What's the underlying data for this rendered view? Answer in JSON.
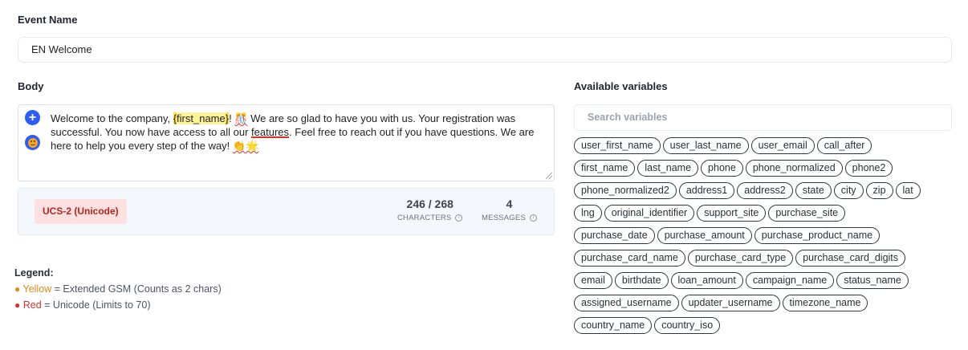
{
  "event": {
    "label": "Event Name",
    "value": "EN Welcome"
  },
  "body": {
    "label": "Body",
    "text_1": "Welcome to the company, ",
    "brace_open": "{",
    "var_name": "first_name",
    "brace_close": "}",
    "text_2": "! ",
    "emoji_1": "🎊",
    "text_3": " We are so glad to have you with us. Your registration was successful. You now have access to all our ",
    "misspelled": "features",
    "text_4": ". Feel free to reach out if you have questions. We are here to help you every step of the way! ",
    "emoji_2": "👏🌟",
    "add_button": "+"
  },
  "stats": {
    "encoding": "UCS-2 (Unicode)",
    "characters_value": "246 / 268",
    "characters_label": "CHARACTERS",
    "messages_value": "4",
    "messages_label": "MESSAGES",
    "info_glyph": "i"
  },
  "legend": {
    "title": "Legend:",
    "bullet": "●",
    "yellow_word": "Yellow",
    "yellow_desc": " = Extended GSM (Counts as 2 chars)",
    "red_word": "Red",
    "red_desc": " = Unicode (Limits to 70)"
  },
  "variables": {
    "label": "Available variables",
    "search_placeholder": "Search variables",
    "rows": [
      [
        "user_first_name",
        "user_last_name",
        "user_email",
        "call_after"
      ],
      [
        "first_name",
        "last_name",
        "phone",
        "phone_normalized",
        "phone2"
      ],
      [
        "phone_normalized2",
        "address1",
        "address2",
        "state",
        "city",
        "zip",
        "lat"
      ],
      [
        "lng",
        "original_identifier",
        "support_site",
        "purchase_site"
      ],
      [
        "purchase_date",
        "purchase_amount",
        "purchase_product_name"
      ],
      [
        "purchase_card_name",
        "purchase_card_type",
        "purchase_card_digits"
      ],
      [
        "email",
        "birthdate",
        "loan_amount",
        "campaign_name",
        "status_name"
      ],
      [
        "assigned_username",
        "updater_username",
        "timezone_name"
      ],
      [
        "country_name",
        "country_iso"
      ]
    ]
  },
  "colors": {
    "accent": "#2f5df4",
    "badge_bg": "#fde1e1",
    "badge_text": "#b3261e",
    "legend_yellow": "#e08a1e",
    "legend_red": "#d6322b"
  }
}
